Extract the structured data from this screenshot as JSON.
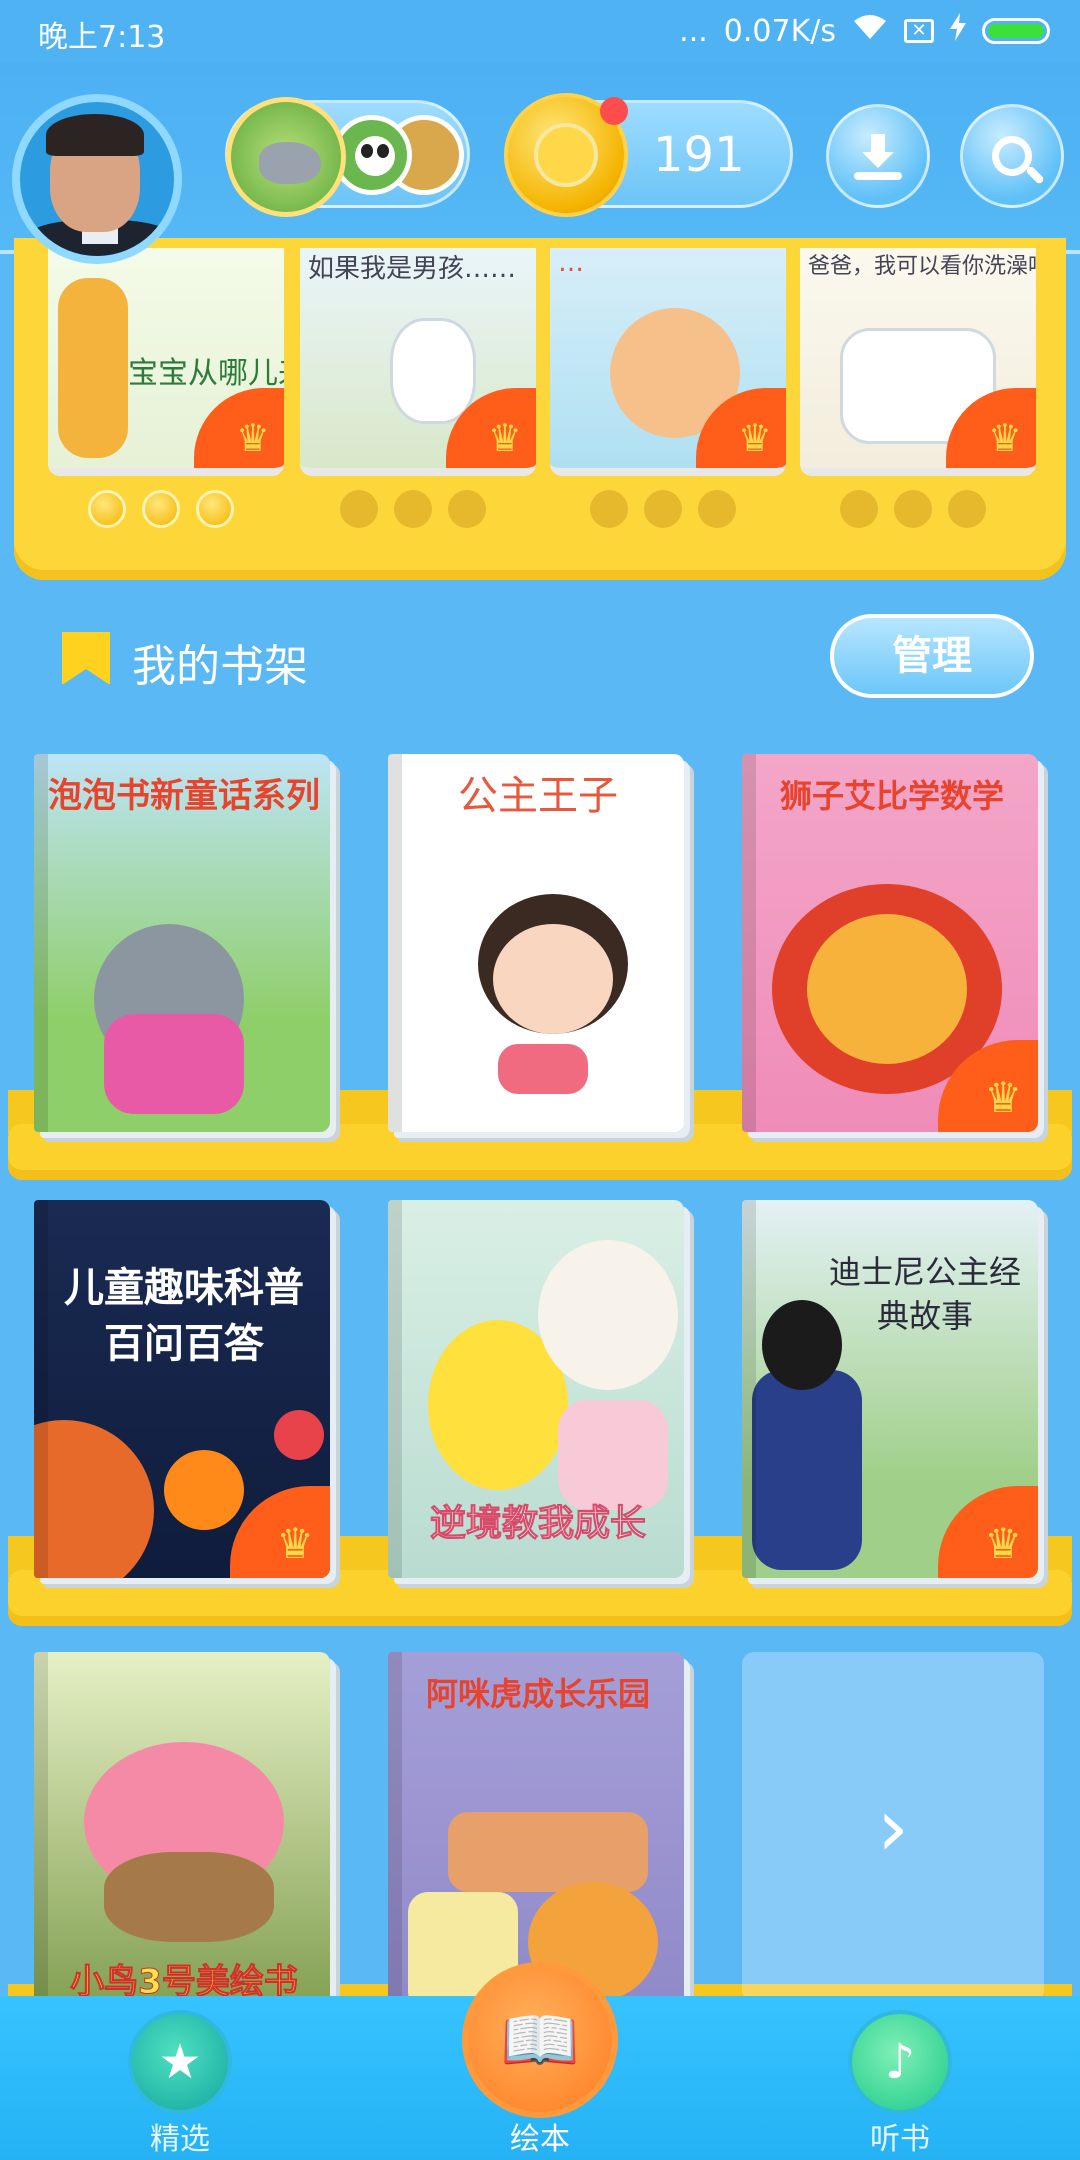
{
  "status_bar": {
    "time": "晚上7:13",
    "network_speed": "0.07K/s",
    "dots": "...",
    "icons": [
      "signal-dots-icon",
      "wifi-icon",
      "sim-off-icon",
      "charging-icon",
      "battery-icon"
    ]
  },
  "header": {
    "avatar": "user-avatar",
    "friends_icons": [
      "rhino-character-icon",
      "panda-character-icon",
      "monkey-character-icon"
    ],
    "coin_count": "191",
    "buttons": [
      "download-icon",
      "search-icon"
    ]
  },
  "recommended": {
    "books": [
      {
        "title": "宝宝从哪儿来"
      },
      {
        "title": "如果我是男孩……"
      },
      {
        "title": "…"
      },
      {
        "title": "爸爸，我可以看你洗澡吗？"
      }
    ]
  },
  "shelf": {
    "title": "我的书架",
    "manage_label": "管理",
    "books": [
      {
        "title": "泡泡书新童话系列"
      },
      {
        "title": "公主王子"
      },
      {
        "title": "狮子艾比学数学"
      },
      {
        "title": "儿童趣味科普百问百答"
      },
      {
        "title": "逆境教我成长"
      },
      {
        "title": "迪士尼公主经典故事"
      },
      {
        "title": "小鸟3号美绘书"
      },
      {
        "title": "阿咪虎成长乐园"
      }
    ],
    "more_label": "›"
  },
  "tabs": [
    {
      "label": "精选"
    },
    {
      "label": "绘本"
    },
    {
      "label": "听书"
    }
  ],
  "colors": {
    "background": "#5ab8f5",
    "shelf_yellow": "#fdd12c",
    "badge_orange": "#ff5e1a",
    "tab_bar": "#25b2f5"
  }
}
